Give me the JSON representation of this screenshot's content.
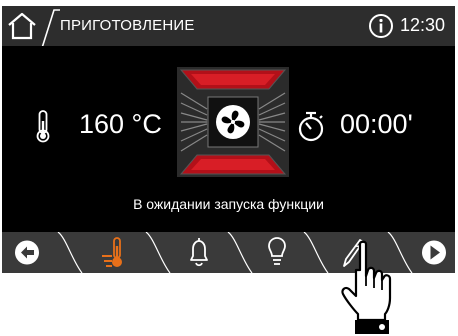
{
  "header": {
    "title": "ПРИГОТОВЛЕНИЕ",
    "time": "12:30",
    "home_icon": "home-icon",
    "info_icon": "info-icon"
  },
  "main": {
    "temperature": "160 °C",
    "temperature_icon": "thermometer-icon",
    "timer": "00:00'",
    "timer_icon": "stopwatch-icon",
    "oven_icon": "oven-fan-heating-icon",
    "status": "В ожидании запуска функции"
  },
  "bottom_nav": {
    "items": [
      {
        "icon": "back-arrow-icon"
      },
      {
        "icon": "heating-thermometer-icon",
        "active": true
      },
      {
        "icon": "bell-icon"
      },
      {
        "icon": "lightbulb-icon"
      },
      {
        "icon": "pen-edit-icon"
      },
      {
        "icon": "play-icon"
      }
    ]
  },
  "colors": {
    "header_bg": "#2d2d2d",
    "screen_bg": "#000000",
    "nav_bg": "#3a3a3a",
    "accent_orange": "#e8701a",
    "heating_red": "#c1121c",
    "text": "#ffffff"
  }
}
